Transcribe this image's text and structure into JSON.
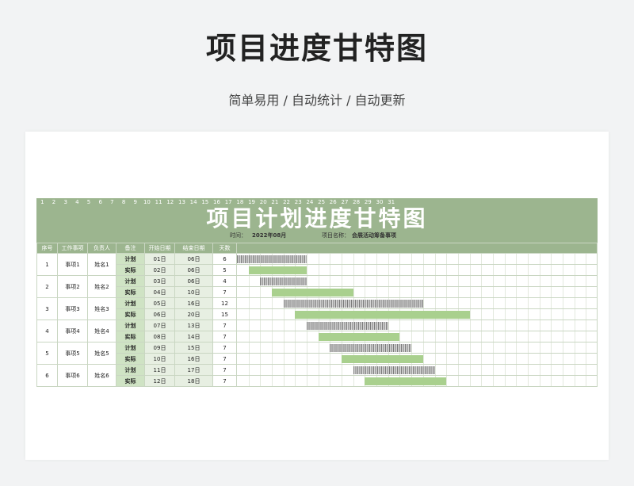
{
  "page": {
    "title": "项目进度甘特图",
    "subtitle": "简单易用 / 自动统计 / 自动更新"
  },
  "sheet": {
    "title": "项目计划进度甘特图",
    "time_label": "时间：",
    "time_value": "2022年08月",
    "project_label": "项目名称：",
    "project_value": "会展活动筹备事项",
    "headers": [
      "序号",
      "工作事项",
      "负责人",
      "备注",
      "开始日期",
      "结束日期",
      "天数"
    ],
    "days": [
      "1",
      "2",
      "3",
      "4",
      "5",
      "6",
      "7",
      "8",
      "9",
      "10",
      "11",
      "12",
      "13",
      "14",
      "15",
      "16",
      "17",
      "18",
      "19",
      "20",
      "21",
      "22",
      "23",
      "24",
      "25",
      "26",
      "27",
      "28",
      "29",
      "30",
      "31"
    ],
    "colors": {
      "header": "#9cb58f",
      "plan_bar": "#7a7a7a",
      "actual_bar": "#a9d08e",
      "note_bg": "#cfe3c4"
    },
    "tasks": [
      {
        "no": "1",
        "task": "事项1",
        "owner": "姓名1",
        "plan": {
          "label": "计划",
          "start": "01日",
          "end": "06日",
          "days": "6",
          "s": 1,
          "e": 6
        },
        "actual": {
          "label": "实际",
          "start": "02日",
          "end": "06日",
          "days": "5",
          "s": 2,
          "e": 6
        }
      },
      {
        "no": "2",
        "task": "事项2",
        "owner": "姓名2",
        "plan": {
          "label": "计划",
          "start": "03日",
          "end": "06日",
          "days": "4",
          "s": 3,
          "e": 6
        },
        "actual": {
          "label": "实际",
          "start": "04日",
          "end": "10日",
          "days": "7",
          "s": 4,
          "e": 10
        }
      },
      {
        "no": "3",
        "task": "事项3",
        "owner": "姓名3",
        "plan": {
          "label": "计划",
          "start": "05日",
          "end": "16日",
          "days": "12",
          "s": 5,
          "e": 16
        },
        "actual": {
          "label": "实际",
          "start": "06日",
          "end": "20日",
          "days": "15",
          "s": 6,
          "e": 20
        }
      },
      {
        "no": "4",
        "task": "事项4",
        "owner": "姓名4",
        "plan": {
          "label": "计划",
          "start": "07日",
          "end": "13日",
          "days": "7",
          "s": 7,
          "e": 13
        },
        "actual": {
          "label": "实际",
          "start": "08日",
          "end": "14日",
          "days": "7",
          "s": 8,
          "e": 14
        }
      },
      {
        "no": "5",
        "task": "事项5",
        "owner": "姓名5",
        "plan": {
          "label": "计划",
          "start": "09日",
          "end": "15日",
          "days": "7",
          "s": 9,
          "e": 15
        },
        "actual": {
          "label": "实际",
          "start": "10日",
          "end": "16日",
          "days": "7",
          "s": 10,
          "e": 16
        }
      },
      {
        "no": "6",
        "task": "事项6",
        "owner": "姓名6",
        "plan": {
          "label": "计划",
          "start": "11日",
          "end": "17日",
          "days": "7",
          "s": 11,
          "e": 17
        },
        "actual": {
          "label": "实际",
          "start": "12日",
          "end": "18日",
          "days": "7",
          "s": 12,
          "e": 18
        }
      }
    ]
  }
}
